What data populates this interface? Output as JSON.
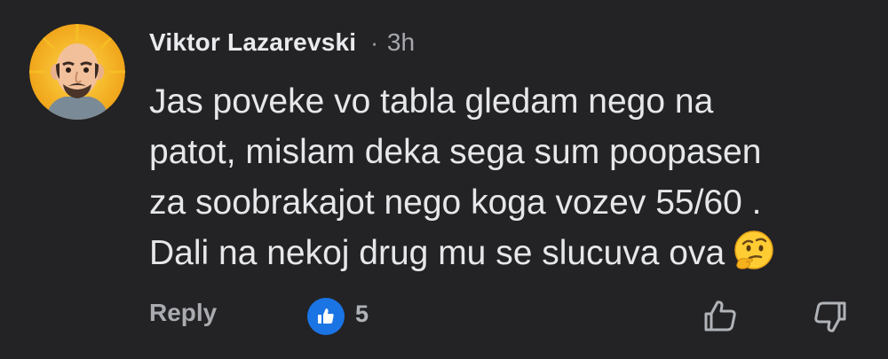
{
  "comment": {
    "author": "Viktor Lazarevski",
    "separator": "·",
    "time": "3h",
    "text_lines": [
      "Jas poveke vo tabla gledam nego na",
      "patot, mislam deka sega sum poopasen",
      "za soobrakajot nego koga vozev 55/60 .",
      "Dali na nekoj drug mu se slucuva ova"
    ],
    "emoji": "thinking-face"
  },
  "actions": {
    "reply_label": "Reply",
    "like_count": "5",
    "like_icon": "thumbs-up-icon",
    "upvote_icon": "thumbs-up-outline-icon",
    "downvote_icon": "thumbs-down-outline-icon"
  },
  "colors": {
    "background": "#232325",
    "text": "#e6e7ea",
    "muted": "#a6a8ad",
    "like_blue": "#1b74e4"
  }
}
